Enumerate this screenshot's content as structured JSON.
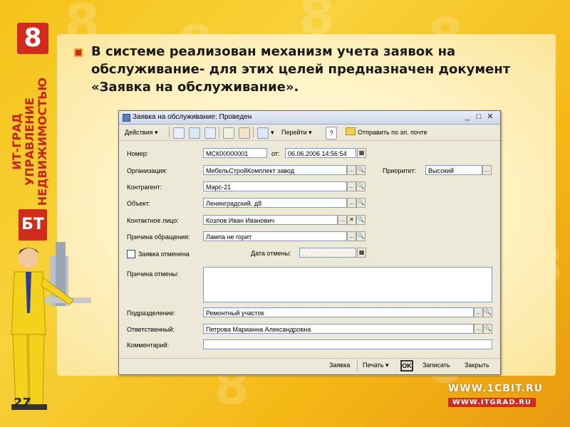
{
  "slide": {
    "headline": "В системе реализован механизм учета заявок на обслуживание- для этих целей предназначен документ «Заявка на обслуживание».",
    "page_number": "27",
    "url_main": "WWW.1CBIT.RU",
    "url_secondary": "WWW.ITGRAD.RU",
    "brand_vertical": "ИТ-ГРАД УПРАВЛЕНИЕ НЕДВИЖИМОСТЬЮ",
    "brand_digit": "8",
    "brand_logo": "БТ",
    "colors": {
      "brand_red": "#d12b1e",
      "background": "#f6c21a"
    }
  },
  "window": {
    "title": "Заявка на обслуживание: Проведен",
    "controls": {
      "minimize": "_",
      "maximize": "□",
      "close": "✕"
    },
    "toolbar": {
      "actions": "Действия",
      "goto": "Перейти",
      "help": "?",
      "send_email": "Отправить по эл. почте"
    },
    "form": {
      "number_label": "Номер:",
      "number_value": "МСК00000001",
      "date_label": "от:",
      "date_value": "06.06.2006 14:56:54",
      "org_label": "Организация:",
      "org_value": "МебельСтройКомплект завод",
      "priority_label": "Приоритет:",
      "priority_value": "Высокий",
      "contractor_label": "Контрагент:",
      "contractor_value": "Марс-21",
      "object_label": "Объект:",
      "object_value": "Ленинградский, д8",
      "contact_label": "Контактное лицо:",
      "contact_value": "Козлов Иван Иванович",
      "reason_label": "Причина обращения:",
      "reason_value": "Лампа не горит",
      "cancelled_label": "Заявка отменена",
      "cancel_date_label": "Дата отмены:",
      "cancel_date_value": ". .",
      "cancel_reason_label": "Причина отмены:",
      "department_label": "Подразделение:",
      "department_value": "Ремонтный участок",
      "responsible_label": "Ответственный:",
      "responsible_value": "Петрова Марианна Александровна",
      "comment_label": "Комментарий:",
      "comment_value": ""
    },
    "bottom": {
      "request": "Заявка",
      "print": "Печать",
      "ok": "OK",
      "save": "Записать",
      "close": "Закрыть"
    }
  }
}
